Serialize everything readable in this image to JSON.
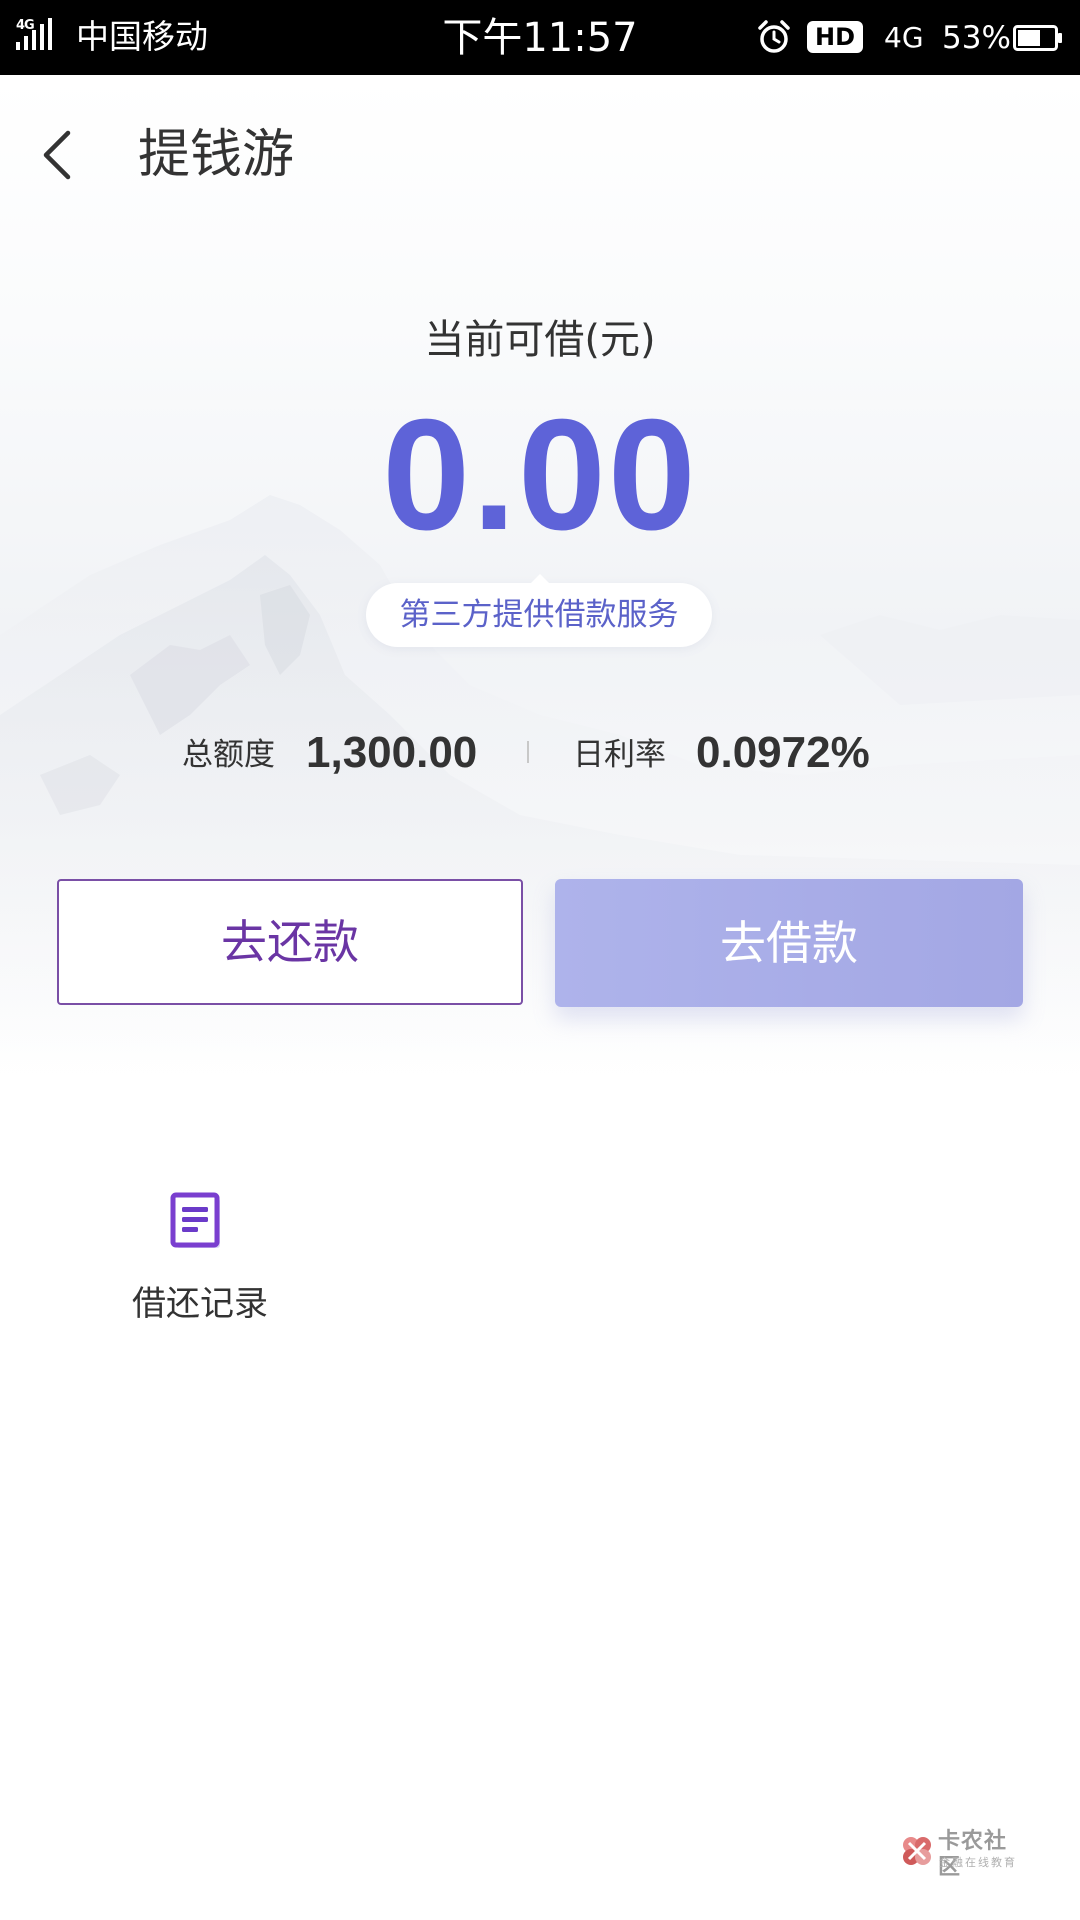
{
  "status_bar": {
    "network_type": "4G",
    "carrier": "中国移动",
    "time": "下午11:57",
    "hd_badge": "HD",
    "network": "4G",
    "battery_percent": "53%"
  },
  "header": {
    "title": "提钱游"
  },
  "balance": {
    "label": "当前可借(元)",
    "amount": "0.00",
    "service_note": "第三方提供借款服务"
  },
  "stats": {
    "limit_label": "总额度",
    "limit_value": "1,300.00",
    "rate_label": "日利率",
    "rate_value": "0.0972%"
  },
  "actions": {
    "repay_label": "去还款",
    "borrow_label": "去借款"
  },
  "entries": [
    {
      "label": "借还记录",
      "icon": "document-list-icon"
    }
  ],
  "watermark": {
    "title": "卡农社区",
    "subtitle": "金融在线教育"
  },
  "colors": {
    "accent": "#5e63d8",
    "repay_border": "#7a4fa6",
    "borrow_button": "#a9ade8",
    "status_bar": "#000000"
  }
}
